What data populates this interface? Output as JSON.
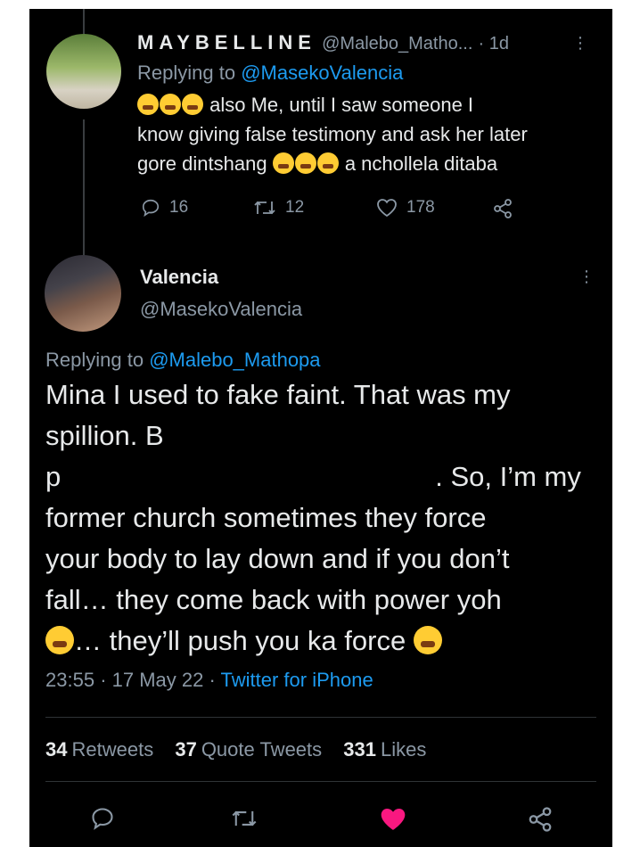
{
  "reply_tweet": {
    "display_name": "MAYBELLINE",
    "handle": "@Malebo_Matho...",
    "time": "· 1d",
    "replying_prefix": "Replying to ",
    "replying_to": "@MasekoValencia",
    "text_line1": "also Me, until I saw someone I",
    "text_line2": "know giving false testimony and ask her later",
    "text_line3a": "gore dintshang",
    "text_line3b": "a nchollela ditaba",
    "replies": "16",
    "retweets": "12",
    "likes": "178"
  },
  "main_tweet": {
    "display_name": "Valencia",
    "handle": "@MasekoValencia",
    "replying_prefix": "Replying to ",
    "replying_to": "@Malebo_Mathopa",
    "line1": "Mina I used to fake faint. That was my",
    "line2": "spillion. B",
    "line3a": "p",
    "line3b": ". So, I’m my",
    "line4": "former church sometimes they force",
    "line5": "your body to lay down and if you don’t",
    "line6": "fall… they come back with power yoh",
    "line7a": "… they’ll push you ka force",
    "time": "23:55",
    "date": "· 17 May 22 ·",
    "source": "Twitter for iPhone",
    "retweets_count": "34",
    "retweets_label": "Retweets",
    "quotes_count": "37",
    "quotes_label": "Quote Tweets",
    "likes_count": "331",
    "likes_label": "Likes"
  },
  "colors": {
    "accent": "#1d9bf0",
    "like": "#f91880",
    "muted": "#8b98a5"
  },
  "icons": [
    "reply-icon",
    "retweet-icon",
    "like-icon",
    "share-icon",
    "more-icon"
  ]
}
